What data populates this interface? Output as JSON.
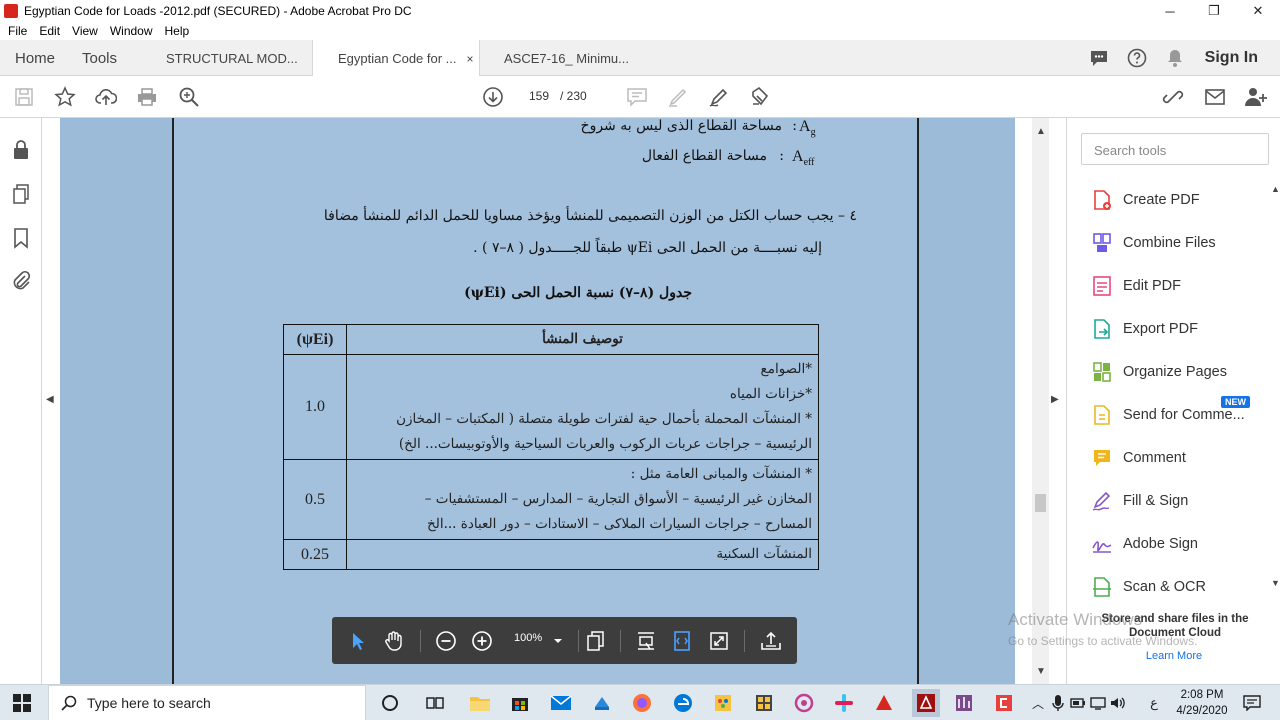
{
  "window": {
    "title": "Egyptian Code for Loads -2012.pdf (SECURED) - Adobe Acrobat Pro DC",
    "controls": [
      "─",
      "❐",
      "✕"
    ]
  },
  "menu": [
    "File",
    "Edit",
    "View",
    "Window",
    "Help"
  ],
  "tabs": {
    "home": "Home",
    "tools": "Tools",
    "docs": [
      "STRUCTURAL MOD...",
      "Egyptian Code for ...",
      "ASCE7-16_ Minimu..."
    ],
    "close": "×",
    "signin": "Sign In"
  },
  "toolbar": {
    "page_current": "159",
    "page_total": "/ 230"
  },
  "document": {
    "ag_label": "مساحة القطاع الذى ليس به شروخ",
    "ag_symbol": "Ag",
    "aeff_label": "مساحة القطاع الفعال",
    "aeff_symbol": "Aeff",
    "colon": ":",
    "item_line1": "٤ – يجب حساب الكتل من الوزن التصميمى للمنشأ ويؤخذ مساويا للحمل الدائم للمنشأ مضافا",
    "item_line2": "إليه نسبــــة من الحمل الحى ψEi طبقاً للجـــــدول ( ٨–٧ ) .",
    "table_title": "جدول (٨–٧) نسبة الحمل الحى (ψEi)",
    "table": {
      "header_value": "(ψEi)",
      "header_desc": "توصيف المنشأ",
      "rows": [
        {
          "value": "1.0",
          "lines": [
            "*الصوامع",
            "*خزانات المياه",
            "* المنشآت المحملة بأحمال حية لفترات طويلة متصلة ( المكتبات – المخازن",
            "الرئيسية – جراجات عربات الركوب والعربات السياحية والأوتوبيسات... الخ)"
          ]
        },
        {
          "value": "0.5",
          "lines": [
            "* المنشآت والمبانى العامة مثل :",
            "المخازن غير الرئيسية – الأسواق التجارية – المدارس – المستشفيات –",
            "المسارح – جراجات السيارات الملاكى – الاستادات – دور العبادة ...الخ"
          ]
        },
        {
          "value": "0.25",
          "lines": [
            "المنشآت السكنية"
          ]
        }
      ]
    }
  },
  "floating_toolbar": {
    "zoom": "100%"
  },
  "right_panel": {
    "search_placeholder": "Search tools",
    "tools": [
      {
        "label": "Create PDF",
        "color": "#e8403c",
        "icon": "create-pdf-icon"
      },
      {
        "label": "Combine Files",
        "color": "#6d5ae6",
        "icon": "combine-files-icon"
      },
      {
        "label": "Edit PDF",
        "color": "#e84a7d",
        "icon": "edit-pdf-icon"
      },
      {
        "label": "Export PDF",
        "color": "#1ea89a",
        "icon": "export-pdf-icon"
      },
      {
        "label": "Organize Pages",
        "color": "#7cb342",
        "icon": "organize-pages-icon"
      },
      {
        "label": "Send for Comme...",
        "color": "#e8b923",
        "icon": "send-comment-icon"
      },
      {
        "label": "Comment",
        "color": "#f2b61a",
        "icon": "comment-icon"
      },
      {
        "label": "Fill & Sign",
        "color": "#8a55c8",
        "icon": "fill-sign-icon"
      },
      {
        "label": "Adobe Sign",
        "color": "#8a55c8",
        "icon": "adobe-sign-icon"
      },
      {
        "label": "Scan & OCR",
        "color": "#4caf50",
        "icon": "scan-ocr-icon"
      }
    ],
    "new_badge": "NEW",
    "promo": "Store and share files in the Document Cloud",
    "learn_more": "Learn More"
  },
  "watermark": {
    "line1": "Activate Windows",
    "line2": "Go to Settings to activate Windows."
  },
  "taskbar": {
    "search_placeholder": "Type here to search",
    "time": "2:08 PM",
    "date": "4/29/2020",
    "lang": "ع"
  }
}
